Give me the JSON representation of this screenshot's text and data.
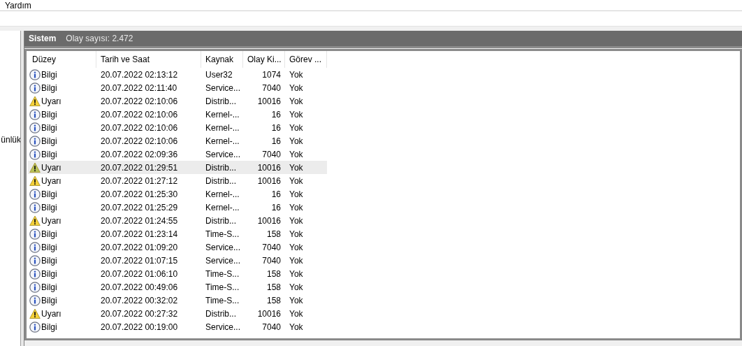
{
  "menu": {
    "items": [
      "Yardım"
    ]
  },
  "sidebar": {
    "items": [
      "ünlük"
    ]
  },
  "panel": {
    "title": "Sistem",
    "subtitle": "Olay sayısı: 2.472"
  },
  "table": {
    "columns": [
      "Düzey",
      "Tarih ve Saat",
      "Kaynak",
      "Olay Ki...",
      "Görev ..."
    ],
    "rows": [
      {
        "kind": "info",
        "level_text": "Bilgi",
        "date": "20.07.2022 02:13:12",
        "source": "User32",
        "event_id": "1074",
        "task": "Yok",
        "selected": false
      },
      {
        "kind": "info",
        "level_text": "Bilgi",
        "date": "20.07.2022 02:11:40",
        "source": "Service...",
        "event_id": "7040",
        "task": "Yok",
        "selected": false
      },
      {
        "kind": "warning",
        "level_text": "Uyarı",
        "date": "20.07.2022 02:10:06",
        "source": "Distrib...",
        "event_id": "10016",
        "task": "Yok",
        "selected": false
      },
      {
        "kind": "info",
        "level_text": "Bilgi",
        "date": "20.07.2022 02:10:06",
        "source": "Kernel-...",
        "event_id": "16",
        "task": "Yok",
        "selected": false
      },
      {
        "kind": "info",
        "level_text": "Bilgi",
        "date": "20.07.2022 02:10:06",
        "source": "Kernel-...",
        "event_id": "16",
        "task": "Yok",
        "selected": false
      },
      {
        "kind": "info",
        "level_text": "Bilgi",
        "date": "20.07.2022 02:10:06",
        "source": "Kernel-...",
        "event_id": "16",
        "task": "Yok",
        "selected": false
      },
      {
        "kind": "info",
        "level_text": "Bilgi",
        "date": "20.07.2022 02:09:36",
        "source": "Service...",
        "event_id": "7040",
        "task": "Yok",
        "selected": false
      },
      {
        "kind": "warning",
        "level_text": "Uyarı",
        "date": "20.07.2022 01:29:51",
        "source": "Distrib...",
        "event_id": "10016",
        "task": "Yok",
        "selected": true
      },
      {
        "kind": "warning",
        "level_text": "Uyarı",
        "date": "20.07.2022 01:27:12",
        "source": "Distrib...",
        "event_id": "10016",
        "task": "Yok",
        "selected": false
      },
      {
        "kind": "info",
        "level_text": "Bilgi",
        "date": "20.07.2022 01:25:30",
        "source": "Kernel-...",
        "event_id": "16",
        "task": "Yok",
        "selected": false
      },
      {
        "kind": "info",
        "level_text": "Bilgi",
        "date": "20.07.2022 01:25:29",
        "source": "Kernel-...",
        "event_id": "16",
        "task": "Yok",
        "selected": false
      },
      {
        "kind": "warning",
        "level_text": "Uyarı",
        "date": "20.07.2022 01:24:55",
        "source": "Distrib...",
        "event_id": "10016",
        "task": "Yok",
        "selected": false
      },
      {
        "kind": "info",
        "level_text": "Bilgi",
        "date": "20.07.2022 01:23:14",
        "source": "Time-S...",
        "event_id": "158",
        "task": "Yok",
        "selected": false
      },
      {
        "kind": "info",
        "level_text": "Bilgi",
        "date": "20.07.2022 01:09:20",
        "source": "Service...",
        "event_id": "7040",
        "task": "Yok",
        "selected": false
      },
      {
        "kind": "info",
        "level_text": "Bilgi",
        "date": "20.07.2022 01:07:15",
        "source": "Service...",
        "event_id": "7040",
        "task": "Yok",
        "selected": false
      },
      {
        "kind": "info",
        "level_text": "Bilgi",
        "date": "20.07.2022 01:06:10",
        "source": "Time-S...",
        "event_id": "158",
        "task": "Yok",
        "selected": false
      },
      {
        "kind": "info",
        "level_text": "Bilgi",
        "date": "20.07.2022 00:49:06",
        "source": "Time-S...",
        "event_id": "158",
        "task": "Yok",
        "selected": false
      },
      {
        "kind": "info",
        "level_text": "Bilgi",
        "date": "20.07.2022 00:32:02",
        "source": "Time-S...",
        "event_id": "158",
        "task": "Yok",
        "selected": false
      },
      {
        "kind": "warning",
        "level_text": "Uyarı",
        "date": "20.07.2022 00:27:32",
        "source": "Distrib...",
        "event_id": "10016",
        "task": "Yok",
        "selected": false
      },
      {
        "kind": "info",
        "level_text": "Bilgi",
        "date": "20.07.2022 00:19:00",
        "source": "Service...",
        "event_id": "7040",
        "task": "Yok",
        "selected": false
      }
    ]
  }
}
